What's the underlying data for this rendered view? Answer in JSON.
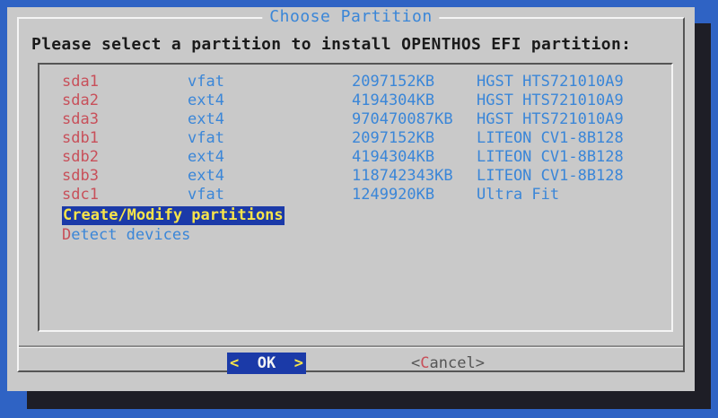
{
  "dialog": {
    "title": "Choose Partition",
    "prompt": "Please select a partition to install OPENTHOS EFI partition:"
  },
  "partitions": [
    {
      "name": "sda1",
      "fs": "vfat",
      "size": "2097152KB",
      "model": "HGST HTS721010A9"
    },
    {
      "name": "sda2",
      "fs": "ext4",
      "size": "4194304KB",
      "model": "HGST HTS721010A9"
    },
    {
      "name": "sda3",
      "fs": "ext4",
      "size": "970470087KB",
      "model": "HGST HTS721010A9"
    },
    {
      "name": "sdb1",
      "fs": "vfat",
      "size": "2097152KB",
      "model": "LITEON CV1-8B128"
    },
    {
      "name": "sdb2",
      "fs": "ext4",
      "size": "4194304KB",
      "model": "LITEON CV1-8B128"
    },
    {
      "name": "sdb3",
      "fs": "ext4",
      "size": "118742343KB",
      "model": "LITEON CV1-8B128"
    },
    {
      "name": "sdc1",
      "fs": "vfat",
      "size": "1249920KB",
      "model": "Ultra Fit"
    }
  ],
  "actions": {
    "create_modify": {
      "hotkey": "C",
      "rest": "reate/Modify partitions"
    },
    "detect_devices": {
      "hotkey": "D",
      "rest": "etect devices"
    }
  },
  "buttons": {
    "ok": {
      "left": "<",
      "label": "OK",
      "right": ">"
    },
    "cancel": {
      "left": "<",
      "hotkey": "C",
      "rest": "ancel",
      "right": ">"
    }
  },
  "colors": {
    "desktop": "#2f63c4",
    "dialog": "#c9c9c9",
    "selection": "#1b3aa8",
    "highlight_text": "#f7e44a",
    "partition_name": "#c8505a",
    "partition_info": "#3a86d8"
  }
}
